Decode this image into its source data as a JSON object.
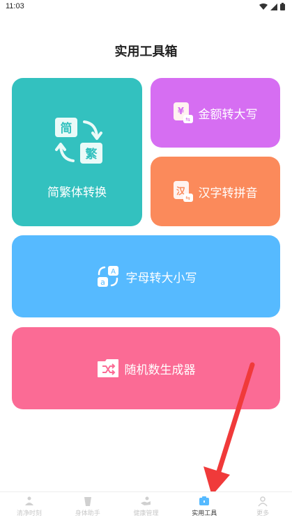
{
  "status": {
    "time": "11:03"
  },
  "title": "实用工具箱",
  "cards": {
    "jianfan": {
      "label": "简繁体转换",
      "glyph_a": "简",
      "glyph_b": "繁",
      "color": "#33c1bf"
    },
    "jine": {
      "label": "金额转大写",
      "glyph": "¥",
      "color": "#d66ef2"
    },
    "hanzi": {
      "label": "汉字转拼音",
      "glyph": "汉",
      "color": "#fb8a5b"
    },
    "zimu": {
      "label": "字母转大小写",
      "glyph_a": "A",
      "glyph_b": "a",
      "color": "#56baff"
    },
    "suiji": {
      "label": "随机数生成器",
      "color": "#fb6b95"
    }
  },
  "tabs": [
    {
      "label": "清净时刻",
      "active": false
    },
    {
      "label": "身体助手",
      "active": false
    },
    {
      "label": "健康管理",
      "active": false
    },
    {
      "label": "实用工具",
      "active": true
    },
    {
      "label": "更多",
      "active": false
    }
  ],
  "annotation_color": "#f03a3a"
}
